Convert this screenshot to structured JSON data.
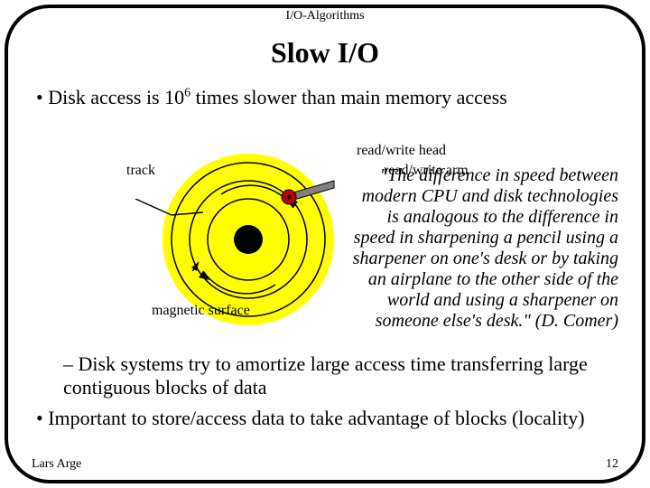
{
  "header": "I/O-Algorithms",
  "title": "Slow I/O",
  "bullet1_prefix": "•   Disk access is 10",
  "bullet1_exp": "6",
  "bullet1_suffix": " times slower than main memory access",
  "labels": {
    "track": "track",
    "head": "read/write head",
    "arm": "read/write arm",
    "surface": "magnetic surface"
  },
  "quote": "\"The difference in speed between modern CPU and disk technologies is analogous to the difference in speed in sharpening a pencil using a sharpener on one's desk or by taking an airplane to the other side of the world and using a sharpener on someone else's desk.\" (D. Comer)",
  "bullet2": "– Disk systems try to amortize large access time transferring large contiguous blocks of data",
  "bullet3": "•  Important to store/access data to take advantage of blocks (locality)",
  "footer": {
    "author": "Lars Arge",
    "page": "12"
  }
}
